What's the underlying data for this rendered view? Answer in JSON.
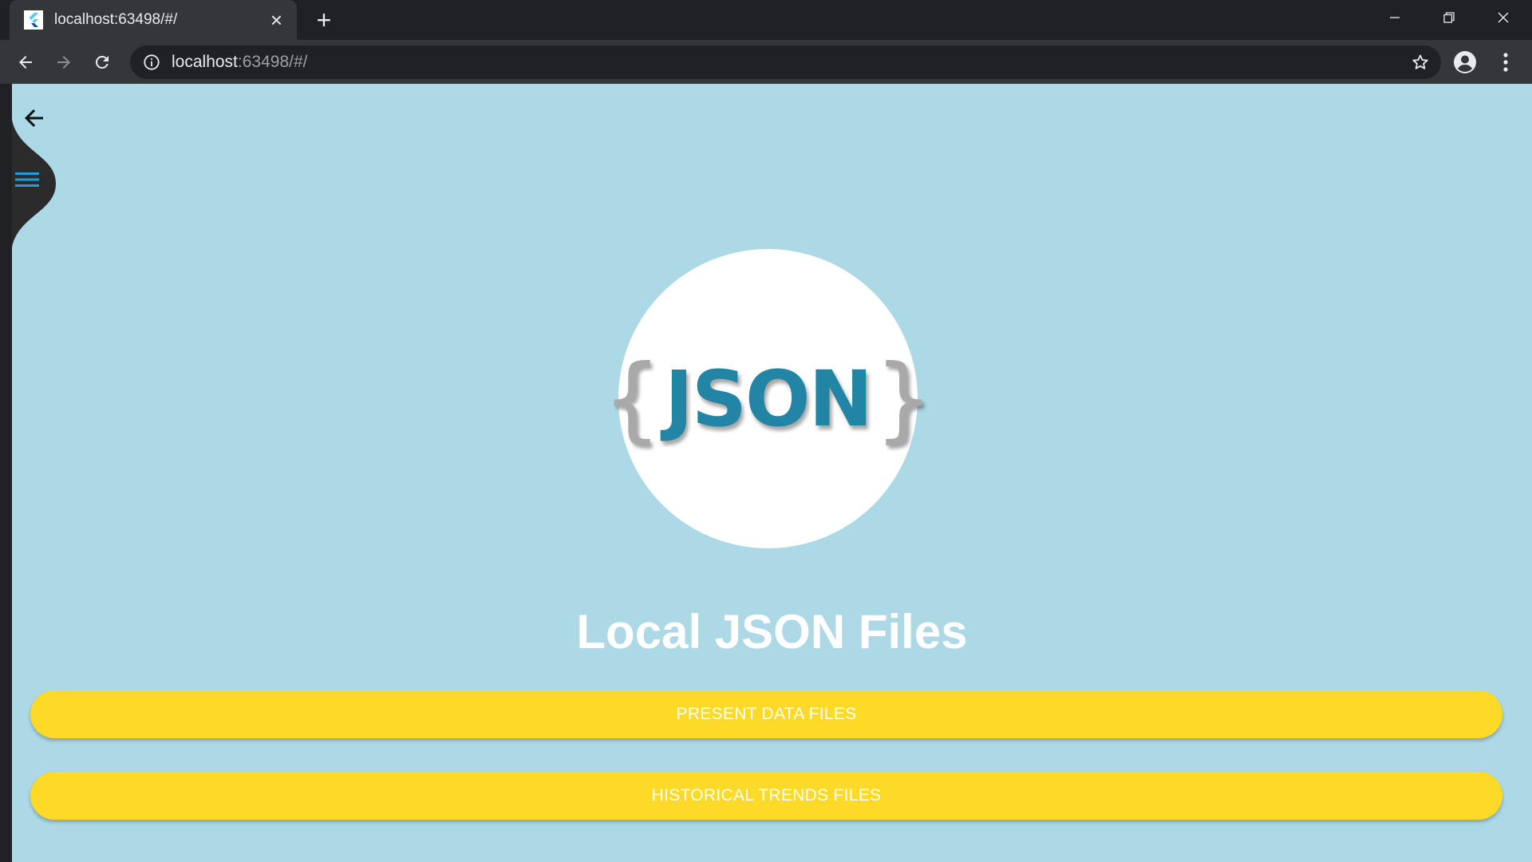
{
  "browser": {
    "tab": {
      "title": "localhost:63498/#/",
      "close_symbol": "×"
    },
    "new_tab_symbol": "+",
    "url": {
      "host": "localhost",
      "rest": ":63498/#/"
    },
    "icons": {
      "favicon": "flutter-icon",
      "back": "arrow-left-icon",
      "forward": "arrow-right-icon",
      "reload": "reload-icon",
      "site_info": "info-icon",
      "bookmark": "star-icon",
      "profile": "profile-icon",
      "menu": "kebab-menu-icon",
      "minimize": "minimize-icon",
      "restore": "restore-icon",
      "close": "close-icon"
    }
  },
  "page": {
    "background_color": "#add8e6",
    "logo": {
      "open_brace": "{",
      "word": "JSON",
      "close_brace": "}"
    },
    "title": "Local JSON Files",
    "buttons": {
      "present": "PRESENT DATA FILES",
      "historical": "HISTORICAL TRENDS FILES"
    },
    "button_color": "#fdd928",
    "accent_color": "#1e9fdc"
  }
}
